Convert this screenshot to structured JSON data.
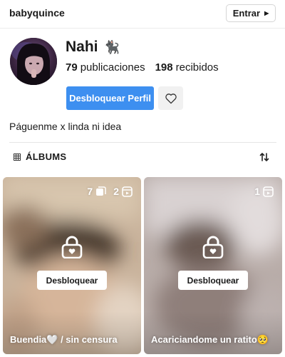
{
  "topbar": {
    "username": "babyquince",
    "login_label": "Entrar",
    "login_caret_icon": "caret-right-icon"
  },
  "profile": {
    "display_name": "Nahi",
    "name_emoji": "🐈‍⬛",
    "posts_count": "79",
    "posts_label": "publicaciones",
    "received_count": "198",
    "received_label": "recibidos",
    "unlock_label": "Desbloquear Perfil",
    "favorite_icon": "heart-outline-icon",
    "bio": "Páguenme x linda ni idea",
    "accent_color": "#3d8ff0"
  },
  "albums": {
    "section_title": "ÁLBUMS",
    "section_icon": "grid-icon",
    "sort_icon": "sort-arrows-icon",
    "items": [
      {
        "photo_count": "7",
        "video_count": "2",
        "unlock_label": "Desbloquear",
        "caption": "Buendia🤍 / sin censura",
        "lock_icon": "lock-heart-icon"
      },
      {
        "video_count": "1",
        "unlock_label": "Desbloquear",
        "caption": "Acariciandome un ratito🥺",
        "lock_icon": "lock-heart-icon"
      }
    ]
  }
}
